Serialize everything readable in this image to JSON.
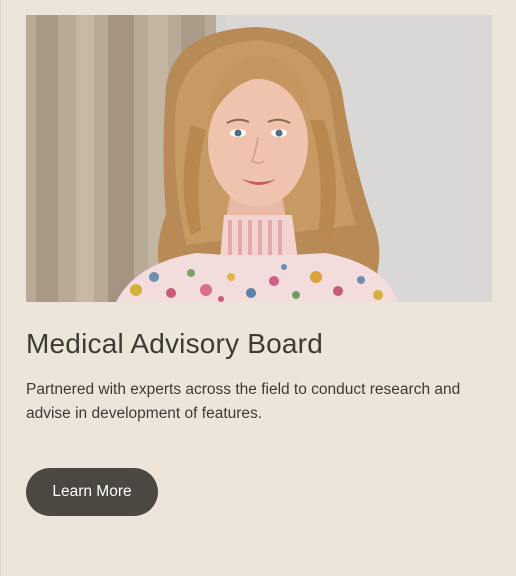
{
  "card": {
    "title": "Medical Advisory Board",
    "description": "Partnered with experts across the field to conduct research and advise in development of features.",
    "button_label": "Learn More"
  },
  "colors": {
    "background": "#eee5da",
    "text": "#3d3a36",
    "button": "#4b4741",
    "button_text": "#ffffff"
  },
  "icons": {
    "photo": "portrait-photo"
  }
}
